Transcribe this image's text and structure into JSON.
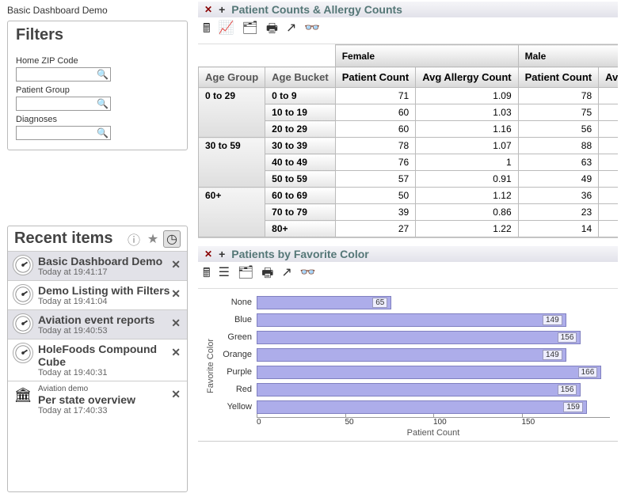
{
  "page_title": "Basic Dashboard Demo",
  "filters": {
    "header": "Filters",
    "zip_label": "Home ZIP Code",
    "group_label": "Patient Group",
    "diag_label": "Diagnoses"
  },
  "recent": {
    "header": "Recent items",
    "items": [
      {
        "label": "Basic Dashboard Demo",
        "time": "Today at 19:41:17",
        "selected": true
      },
      {
        "label": "Demo Listing with Filters",
        "time": "Today at 19:41:04"
      },
      {
        "label": "Aviation event reports",
        "time": "Today at 19:40:53",
        "selected": true
      },
      {
        "label": "HoleFoods Compound Cube",
        "time": "Today at 19:40:31"
      },
      {
        "subtitle": "Aviation demo",
        "label": "Per state overview",
        "time": "Today at 17:40:33",
        "bank": true
      }
    ]
  },
  "widget1": {
    "title": "Patient Counts & Allergy Counts",
    "header_female": "Female",
    "header_male": "Male",
    "col_pc": "Patient Count",
    "col_ac": "Avg Allergy Count",
    "col_ac2": "Avg Allergy",
    "dim1": "Age Group",
    "dim2": "Age Bucket",
    "groups": [
      {
        "name": "0 to 29",
        "rows": [
          {
            "bucket": "0 to 9",
            "fpc": "71",
            "fac": "1.09",
            "mpc": "78"
          },
          {
            "bucket": "10 to 19",
            "fpc": "60",
            "fac": "1.03",
            "mpc": "75"
          },
          {
            "bucket": "20 to 29",
            "fpc": "60",
            "fac": "1.16",
            "mpc": "56"
          }
        ]
      },
      {
        "name": "30 to 59",
        "rows": [
          {
            "bucket": "30 to 39",
            "fpc": "78",
            "fac": "1.07",
            "mpc": "88"
          },
          {
            "bucket": "40 to 49",
            "fpc": "76",
            "fac": "1",
            "mpc": "63"
          },
          {
            "bucket": "50 to 59",
            "fpc": "57",
            "fac": "0.91",
            "mpc": "49"
          }
        ]
      },
      {
        "name": "60+",
        "rows": [
          {
            "bucket": "60 to 69",
            "fpc": "50",
            "fac": "1.12",
            "mpc": "36"
          },
          {
            "bucket": "70 to 79",
            "fpc": "39",
            "fac": "0.86",
            "mpc": "23"
          },
          {
            "bucket": "80+",
            "fpc": "27",
            "fac": "1.22",
            "mpc": "14"
          }
        ]
      }
    ]
  },
  "widget2": {
    "title": "Patients by Favorite Color",
    "ylabel": "Favorite Color",
    "xlabel": "Patient Count"
  },
  "chart_data": {
    "type": "bar",
    "orientation": "horizontal",
    "categories": [
      "None",
      "Blue",
      "Green",
      "Orange",
      "Purple",
      "Red",
      "Yellow"
    ],
    "values": [
      65,
      149,
      156,
      149,
      166,
      156,
      159
    ],
    "xlabel": "Patient Count",
    "ylabel": "Favorite Color",
    "xticks": [
      0,
      50,
      100,
      150
    ],
    "xlim": [
      0,
      170
    ]
  }
}
